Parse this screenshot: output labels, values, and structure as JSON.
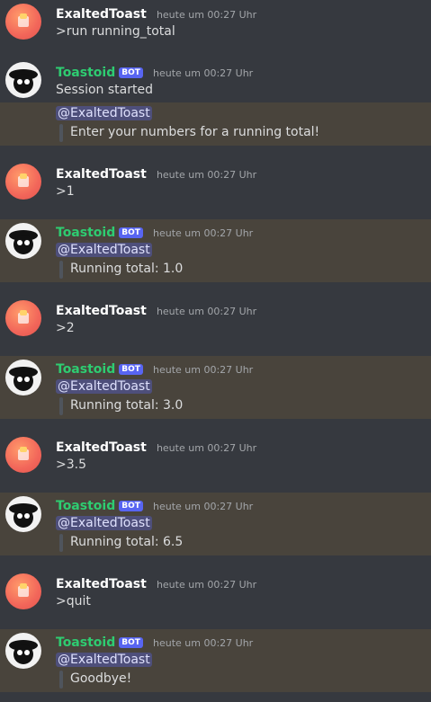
{
  "users": {
    "user_name": "ExaltedToast",
    "bot_name": "Toastoid",
    "bot_badge": "BOT"
  },
  "timestamp": "heute um 00:27 Uhr",
  "messages": [
    {
      "author": "ExaltedToast",
      "time": "heute um 00:27 Uhr",
      "text": ">run running_total"
    },
    {
      "author": "Toastoid",
      "badge": "BOT",
      "time": "heute um 00:27 Uhr",
      "text": "Session started",
      "mention": "@ExaltedToast",
      "quote": "Enter your numbers for a running total!"
    },
    {
      "author": "ExaltedToast",
      "time": "heute um 00:27 Uhr",
      "text": ">1"
    },
    {
      "author": "Toastoid",
      "badge": "BOT",
      "time": "heute um 00:27 Uhr",
      "mention": "@ExaltedToast",
      "quote": "Running total: 1.0"
    },
    {
      "author": "ExaltedToast",
      "time": "heute um 00:27 Uhr",
      "text": ">2"
    },
    {
      "author": "Toastoid",
      "badge": "BOT",
      "time": "heute um 00:27 Uhr",
      "mention": "@ExaltedToast",
      "quote": "Running total: 3.0"
    },
    {
      "author": "ExaltedToast",
      "time": "heute um 00:27 Uhr",
      "text": ">3.5"
    },
    {
      "author": "Toastoid",
      "badge": "BOT",
      "time": "heute um 00:27 Uhr",
      "mention": "@ExaltedToast",
      "quote": "Running total: 6.5"
    },
    {
      "author": "ExaltedToast",
      "time": "heute um 00:27 Uhr",
      "text": ">quit"
    },
    {
      "author": "Toastoid",
      "badge": "BOT",
      "time": "heute um 00:27 Uhr",
      "mention": "@ExaltedToast",
      "quote": "Goodbye!"
    }
  ],
  "colors": {
    "background": "#36393f",
    "highlight": "#49443c",
    "bot_name": "#2ecc71",
    "badge": "#5865f2"
  },
  "icons": {
    "user_avatar": "toast-avatar-icon",
    "bot_avatar": "toastoid-avatar-icon"
  }
}
